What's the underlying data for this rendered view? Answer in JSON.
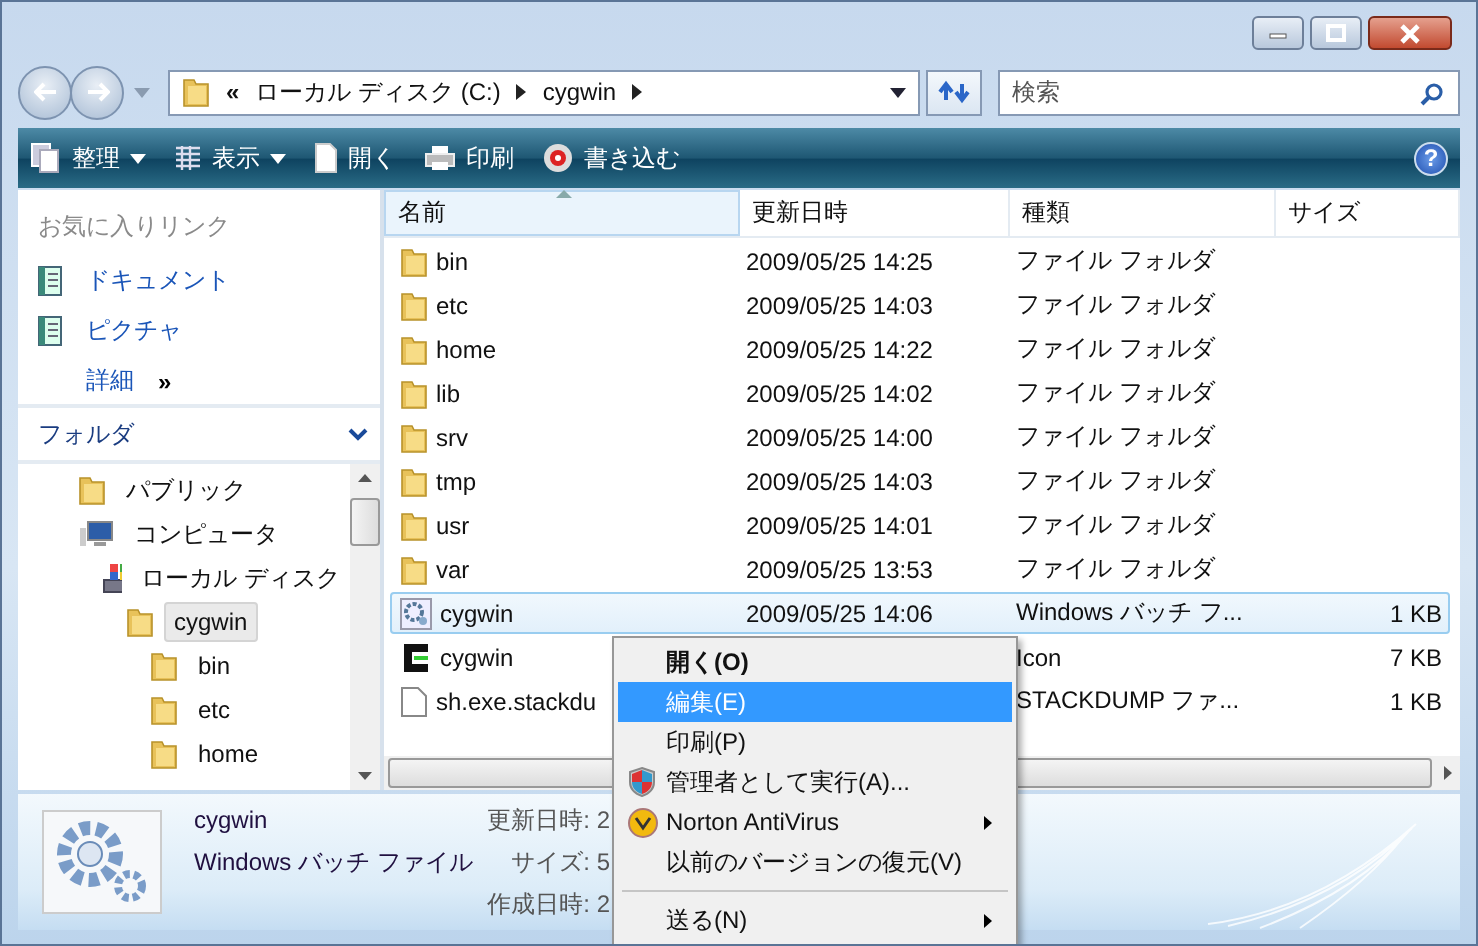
{
  "address": {
    "overflow": "«",
    "crumbs": [
      "ローカル ディスク (C:)",
      "cygwin"
    ]
  },
  "search": {
    "placeholder": "検索"
  },
  "help": "?",
  "toolbar": [
    {
      "label": "整理",
      "kind": "organize",
      "dropdown": true
    },
    {
      "label": "表示",
      "kind": "views",
      "dropdown": true
    },
    {
      "label": "開く",
      "kind": "open",
      "dropdown": false
    },
    {
      "label": "印刷",
      "kind": "print",
      "dropdown": false
    },
    {
      "label": "書き込む",
      "kind": "burn",
      "dropdown": false
    }
  ],
  "favorites": {
    "title": "お気に入りリンク",
    "links": [
      {
        "label": "ドキュメント",
        "kind": "link"
      },
      {
        "label": "ピクチャ",
        "kind": "link"
      },
      {
        "label": "詳細",
        "kind": "more"
      }
    ],
    "more_mark": "»"
  },
  "folders": {
    "title": "フォルダ",
    "tree": [
      {
        "label": "パブリック",
        "kind": "folder",
        "selected": false
      },
      {
        "label": "コンピュータ",
        "kind": "computer",
        "selected": false,
        "children": [
          {
            "label": "ローカル ディスク",
            "kind": "drive",
            "selected": false,
            "children": [
              {
                "label": "cygwin",
                "kind": "folder",
                "selected": true,
                "children": [
                  {
                    "label": "bin",
                    "kind": "folder",
                    "selected": false
                  },
                  {
                    "label": "etc",
                    "kind": "folder",
                    "selected": false
                  },
                  {
                    "label": "home",
                    "kind": "folder",
                    "selected": false
                  }
                ]
              }
            ]
          }
        ]
      }
    ]
  },
  "table": {
    "columns": [
      "名前",
      "更新日時",
      "種類",
      "サイズ"
    ],
    "rows": [
      {
        "kind": "folder",
        "name": "bin",
        "date": "2009/05/25 14:25",
        "type": "ファイル フォルダ",
        "size": "",
        "selected": false
      },
      {
        "kind": "folder",
        "name": "etc",
        "date": "2009/05/25 14:03",
        "type": "ファイル フォルダ",
        "size": "",
        "selected": false
      },
      {
        "kind": "folder",
        "name": "home",
        "date": "2009/05/25 14:22",
        "type": "ファイル フォルダ",
        "size": "",
        "selected": false
      },
      {
        "kind": "folder",
        "name": "lib",
        "date": "2009/05/25 14:02",
        "type": "ファイル フォルダ",
        "size": "",
        "selected": false
      },
      {
        "kind": "folder",
        "name": "srv",
        "date": "2009/05/25 14:00",
        "type": "ファイル フォルダ",
        "size": "",
        "selected": false
      },
      {
        "kind": "folder",
        "name": "tmp",
        "date": "2009/05/25 14:03",
        "type": "ファイル フォルダ",
        "size": "",
        "selected": false
      },
      {
        "kind": "folder",
        "name": "usr",
        "date": "2009/05/25 14:01",
        "type": "ファイル フォルダ",
        "size": "",
        "selected": false
      },
      {
        "kind": "folder",
        "name": "var",
        "date": "2009/05/25 13:53",
        "type": "ファイル フォルダ",
        "size": "",
        "selected": false
      },
      {
        "kind": "batch",
        "name": "cygwin",
        "date": "2009/05/25 14:06",
        "type": "Windows バッチ フ...",
        "size": "1 KB",
        "selected": true
      },
      {
        "kind": "icon",
        "name": "cygwin",
        "date": "",
        "type": "Icon",
        "size": "7 KB",
        "selected": false
      },
      {
        "kind": "file",
        "name": "sh.exe.stackdu",
        "date": "",
        "type": "STACKDUMP ファ...",
        "size": "1 KB",
        "selected": false
      }
    ]
  },
  "details": {
    "name": "cygwin",
    "type": "Windows バッチ ファイル",
    "fields": [
      "更新日時: 2",
      "サイズ: 5",
      "作成日時: 2"
    ]
  },
  "context_menu": [
    {
      "label": "開く(O)",
      "kind": "command",
      "default": true,
      "selected": false,
      "submenu": false
    },
    {
      "label": "編集(E)",
      "kind": "command",
      "default": false,
      "selected": true,
      "submenu": false
    },
    {
      "label": "印刷(P)",
      "kind": "command",
      "default": false,
      "selected": false,
      "submenu": false
    },
    {
      "label": "管理者として実行(A)...",
      "kind": "elevated",
      "default": false,
      "selected": false,
      "submenu": false
    },
    {
      "label": "Norton AntiVirus",
      "kind": "extension",
      "default": false,
      "selected": false,
      "submenu": true
    },
    {
      "label": "以前のバージョンの復元(V)",
      "kind": "command",
      "default": false,
      "selected": false,
      "submenu": false
    },
    {
      "kind": "separator"
    },
    {
      "label": "送る(N)",
      "kind": "command",
      "default": false,
      "selected": false,
      "submenu": true
    }
  ]
}
